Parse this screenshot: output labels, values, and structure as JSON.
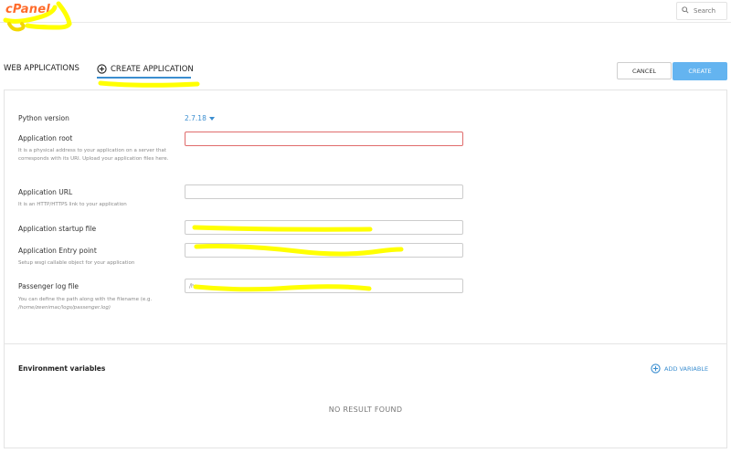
{
  "header": {
    "logo_text": "cPanel",
    "search_placeholder": "Search"
  },
  "tabs": {
    "web_applications": "WEB APPLICATIONS",
    "create_application": "CREATE APPLICATION"
  },
  "actions": {
    "cancel": "CANCEL",
    "create": "CREATE"
  },
  "form": {
    "python_version": {
      "label": "Python version",
      "value": "2.7.18"
    },
    "application_root": {
      "label": "Application root",
      "help": "It is a physical address to your application on a server that corresponds with its URI. Upload your application files here.",
      "value": ""
    },
    "application_url": {
      "label": "Application URL",
      "help": "It is an HTTP/HTTPS link to your application",
      "value": ""
    },
    "startup_file": {
      "label": "Application startup file",
      "value": ""
    },
    "entry_point": {
      "label": "Application Entry point",
      "help": "Setup wsgi callable object for your application",
      "value": ""
    },
    "passenger_log": {
      "label": "Passenger log file",
      "help_prefix": "You can define the path along with the filename (e.g.",
      "help_example": "/home/zeenimac/logs/passenger.log)",
      "value": "/h"
    }
  },
  "environment": {
    "title": "Environment variables",
    "add_label": "ADD VARIABLE",
    "empty_text": "NO RESULT FOUND"
  },
  "colors": {
    "accent": "#3b8ed0",
    "create_button": "#64b4f0",
    "logo": "#ff6c2c",
    "invalid_border": "#e06c6c",
    "highlight": "#ffff00"
  }
}
